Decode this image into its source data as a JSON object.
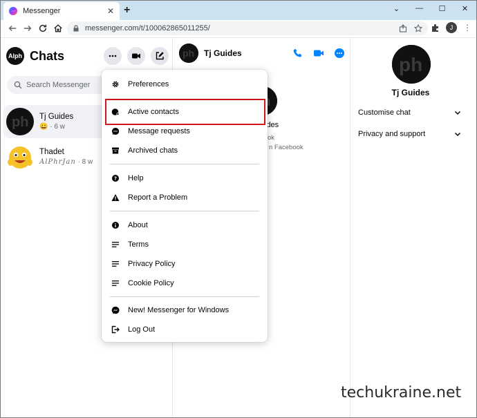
{
  "browser": {
    "tab_title": "Messenger",
    "tab_close": "✕",
    "new_tab": "+",
    "window_controls": [
      "⌄",
      "—",
      "☐",
      "✕"
    ],
    "url": "messenger.com/t/100062865011255/",
    "profile_initial": "J"
  },
  "sidebar": {
    "title": "Chats",
    "me_avatar_text": "Alph",
    "search_placeholder": "Search Messenger",
    "conversations": [
      {
        "name": "Tj Guides",
        "emoji": "😀",
        "time": "· 6 w",
        "active": true
      },
      {
        "name": "Thadet",
        "preview": "AlPhrJan",
        "time": "· 8 w",
        "active": false
      }
    ]
  },
  "chat": {
    "header_name": "Tj Guides",
    "bg_name_fragment": "ides",
    "bg_sub1": "ok",
    "bg_sub2": "n Facebook"
  },
  "info_panel": {
    "name": "Tj Guides",
    "sections": [
      "Customise chat",
      "Privacy and support"
    ]
  },
  "menu": {
    "items": [
      {
        "label": "Preferences",
        "icon": "gear-icon"
      },
      {
        "label": "Active contacts",
        "icon": "active-contacts-icon",
        "highlighted": true
      },
      {
        "label": "Message requests",
        "icon": "message-requests-icon"
      },
      {
        "label": "Archived chats",
        "icon": "archive-icon"
      },
      {
        "label": "Help",
        "icon": "help-icon"
      },
      {
        "label": "Report a Problem",
        "icon": "warning-icon"
      },
      {
        "label": "About",
        "icon": "info-icon"
      },
      {
        "label": "Terms",
        "icon": "lines-icon"
      },
      {
        "label": "Privacy Policy",
        "icon": "lines-icon"
      },
      {
        "label": "Cookie Policy",
        "icon": "lines-icon"
      },
      {
        "label": "New! Messenger for Windows",
        "icon": "messenger-icon"
      },
      {
        "label": "Log Out",
        "icon": "logout-icon"
      }
    ]
  },
  "watermark": "techukraine.net",
  "colors": {
    "accent": "#0084ff",
    "highlight_box": "#d0141b",
    "tabstrip": "#cde2f1"
  }
}
